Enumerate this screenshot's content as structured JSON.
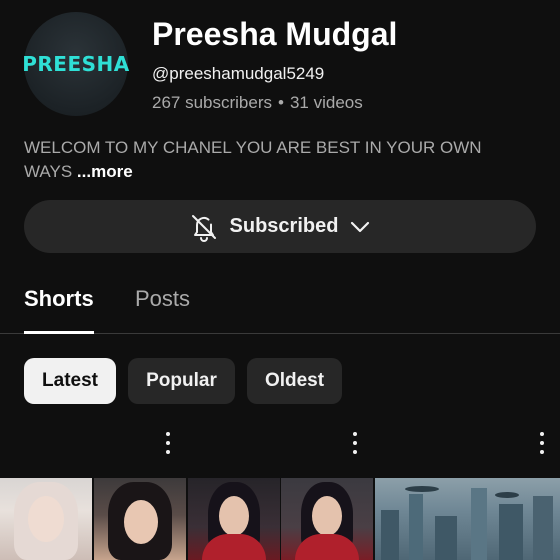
{
  "channel": {
    "avatar_text": "PREESHA",
    "name": "Preesha Mudgal",
    "handle": "@preeshamudgal5249",
    "subscribers": "267 subscribers",
    "separator": "•",
    "videos": "31 videos",
    "description": "WELCOM TO MY CHANEL YOU ARE BEST IN YOUR OWN WAYS",
    "more_label": "...more"
  },
  "subscribe": {
    "label": "Subscribed",
    "icon": "bell-off-icon",
    "chevron_icon": "chevron-down-icon"
  },
  "tabs": [
    {
      "label": "Shorts",
      "active": true
    },
    {
      "label": "Posts",
      "active": false
    }
  ],
  "filters": [
    {
      "label": "Latest",
      "selected": true
    },
    {
      "label": "Popular",
      "selected": false
    },
    {
      "label": "Oldest",
      "selected": false
    }
  ],
  "colors": {
    "background": "#0f0f0f",
    "button_bg": "#272727",
    "avatar_text": "#2fe0d6",
    "secondary_text": "#aaaaaa"
  }
}
